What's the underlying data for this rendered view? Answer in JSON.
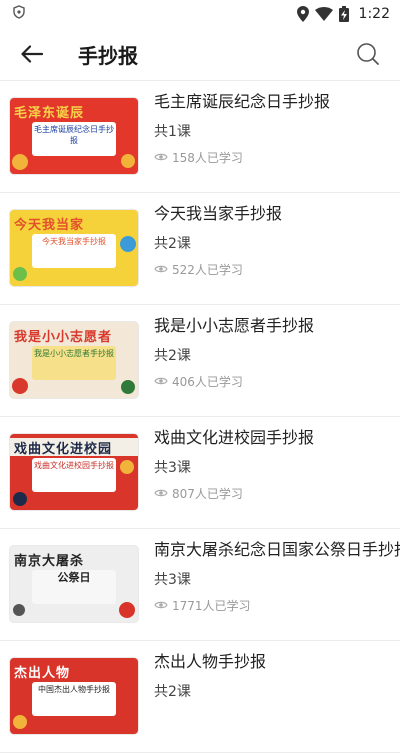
{
  "status_bar": {
    "time": "1:22"
  },
  "header": {
    "title": "手抄报"
  },
  "courses": [
    {
      "title": "毛主席诞辰纪念日手抄报",
      "count": "共1课",
      "learners": "158人已学习",
      "thumb": {
        "banner": "毛泽东诞辰",
        "inner": "毛主席诞辰纪念日手抄报",
        "bg": "#e3372b",
        "inner_color": "#1a3fa0",
        "banner_color": "#f7d54a"
      }
    },
    {
      "title": "今天我当家手抄报",
      "count": "共2课",
      "learners": "522人已学习",
      "thumb": {
        "banner": "今天我当家",
        "inner": "今天我当家手抄报",
        "bg": "#f6d23a",
        "inner_color": "#e2512c",
        "banner_color": "#e2512c"
      }
    },
    {
      "title": "我是小小志愿者手抄报",
      "count": "共2课",
      "learners": "406人已学习",
      "thumb": {
        "banner": "我是小小志愿者",
        "inner": "我是小小志愿者手抄报",
        "bg": "#f3e7d8",
        "inner_color": "#2f7a38",
        "banner_color": "#d8392c"
      }
    },
    {
      "title": "戏曲文化进校园手抄报",
      "count": "共3课",
      "learners": "807人已学习",
      "thumb": {
        "banner": "戏曲文化进校园",
        "inner": "戏曲文化进校园手抄报",
        "bg": "#d9352b",
        "inner_color": "#c8302a",
        "banner_color": "#1e2a4a"
      }
    },
    {
      "title": "南京大屠杀纪念日国家公祭日手抄报",
      "count": "共3课",
      "learners": "1771人已学习",
      "thumb": {
        "banner": "南京大屠杀",
        "inner": "公祭日",
        "bg": "#eeeeee",
        "inner_color": "#222222",
        "banner_color": "#222222"
      }
    },
    {
      "title": "杰出人物手抄报",
      "count": "共2课",
      "learners": "",
      "thumb": {
        "banner": "杰出人物",
        "inner": "中国杰出人物手抄报",
        "bg": "#d8342a",
        "inner_color": "#222222",
        "banner_color": "#ffffff"
      }
    }
  ]
}
